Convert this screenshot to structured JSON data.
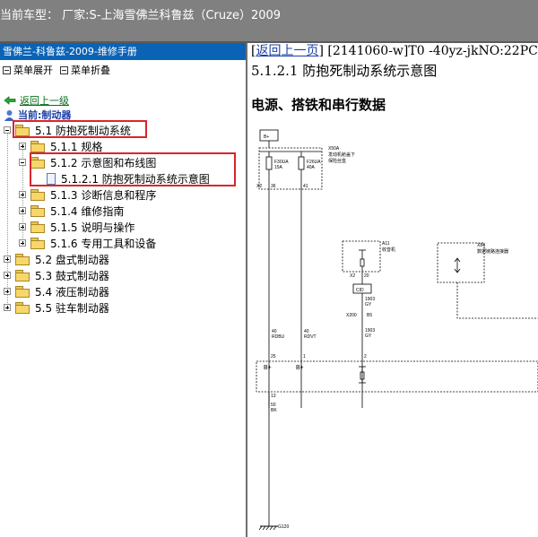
{
  "topbar": {
    "title": "当前车型：  厂家:S-上海雪佛兰科鲁兹（Cruze）2009"
  },
  "sidebar": {
    "header": "雪佛兰-科鲁兹-2009-维修手册",
    "expand_all": "菜单展开",
    "collapse_all": "菜单折叠",
    "back": "返回上一级",
    "current": "当前:制动器",
    "tree": [
      {
        "label": "5.1 防抱死制动系统"
      },
      {
        "label": "5.1.1 规格"
      },
      {
        "label": "5.1.2 示意图和布线图"
      },
      {
        "label": "5.1.2.1 防抱死制动系统示意图"
      },
      {
        "label": "5.1.3 诊断信息和程序"
      },
      {
        "label": "5.1.4 维修指南"
      },
      {
        "label": "5.1.5 说明与操作"
      },
      {
        "label": "5.1.6 专用工具和设备"
      },
      {
        "label": "5.2 盘式制动器"
      },
      {
        "label": "5.3 鼓式制动器"
      },
      {
        "label": "5.4 液压制动器"
      },
      {
        "label": "5.5 驻车制动器"
      }
    ]
  },
  "content": {
    "back_link": "返回上一页",
    "doc_code": "[2141060-w]T0 -40yz-jkNO:22PC",
    "title": "5.1.2.1 防抱死制动系统示意图",
    "section": "电源、搭铁和串行数据"
  },
  "diagram": {
    "b_plus": "B+",
    "x50a": "X50A",
    "x50a_desc1": "发动机舱盖下",
    "x50a_desc2": "保险丝盒",
    "fuse1_name": "F30UA",
    "fuse1_amp": "15A",
    "fuse2_name": "F26UA",
    "fuse2_amp": "40A",
    "x2": "X2",
    "pin36": "36",
    "pin41": "41",
    "a11": "A11",
    "a11_desc": "收音机",
    "x84": "X84",
    "x84_desc": "数据链路连接器",
    "x2b": "X2",
    "pin20": "20",
    "cid": "CID",
    "w1903a": "1903",
    "gya": "GY",
    "x200": "X200",
    "b5": "B5",
    "w40a": "40",
    "rdbu": "RDBU",
    "w40b": "40",
    "rdvt": "RDVT",
    "w1903b": "1903",
    "gyb": "GY",
    "p25": "25",
    "p1": "1",
    "p2": "2",
    "bplus1": "B+",
    "bplus2": "B+",
    "p13": "13",
    "w50": "50",
    "bk": "BK",
    "g120": "G120"
  }
}
